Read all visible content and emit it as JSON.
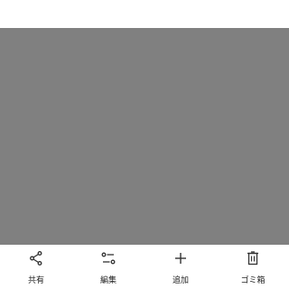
{
  "colors": {
    "media_background": "#808080",
    "bar_background": "#ffffff",
    "icon_color": "#333333",
    "label_color": "#222222"
  },
  "actions": [
    {
      "label": "共有",
      "icon": "share-icon"
    },
    {
      "label": "編集",
      "icon": "edit-sliders-icon"
    },
    {
      "label": "追加",
      "icon": "plus-icon"
    },
    {
      "label": "ゴミ箱",
      "icon": "trash-icon"
    }
  ]
}
